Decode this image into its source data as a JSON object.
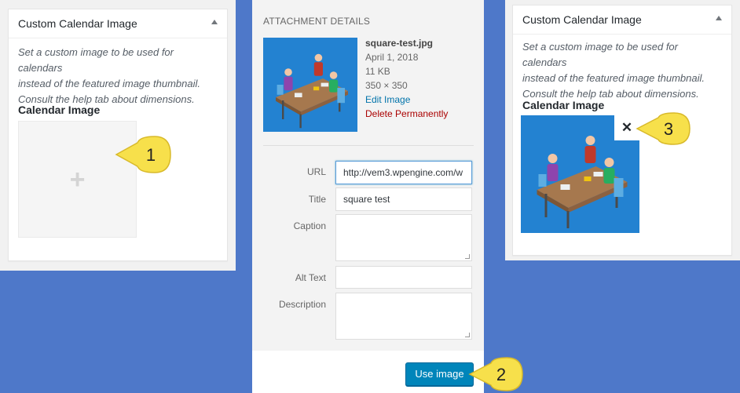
{
  "left_panel": {
    "title": "Custom Calendar Image",
    "description": [
      "Set a custom image to be used for calendars",
      "instead of the featured image thumbnail.",
      "Consult the help tab about dimensions."
    ],
    "field_label": "Calendar Image",
    "add_icon": "plus-icon"
  },
  "attachment": {
    "heading": "ATTACHMENT DETAILS",
    "filename": "square-test.jpg",
    "date": "April 1, 2018",
    "size": "11 KB",
    "dimensions": "350 × 350",
    "edit_link": "Edit Image",
    "delete_link": "Delete Permanently",
    "fields": {
      "url_label": "URL",
      "url_value": "http://vem3.wpengine.com/w",
      "title_label": "Title",
      "title_value": "square test",
      "caption_label": "Caption",
      "caption_value": "",
      "alt_label": "Alt Text",
      "alt_value": "",
      "description_label": "Description",
      "description_value": ""
    },
    "use_button": "Use image"
  },
  "right_panel": {
    "title": "Custom Calendar Image",
    "description": [
      "Set a custom image to be used for calendars",
      "instead of the featured image thumbnail.",
      "Consult the help tab about dimensions."
    ],
    "field_label": "Calendar Image",
    "remove_label": "✕"
  },
  "callouts": {
    "one": "1",
    "two": "2",
    "three": "3"
  },
  "colors": {
    "background": "#4e78c9",
    "primary_button": "#0085ba",
    "link": "#0073aa",
    "delete": "#aa0000",
    "callout": "#f7e04b"
  }
}
